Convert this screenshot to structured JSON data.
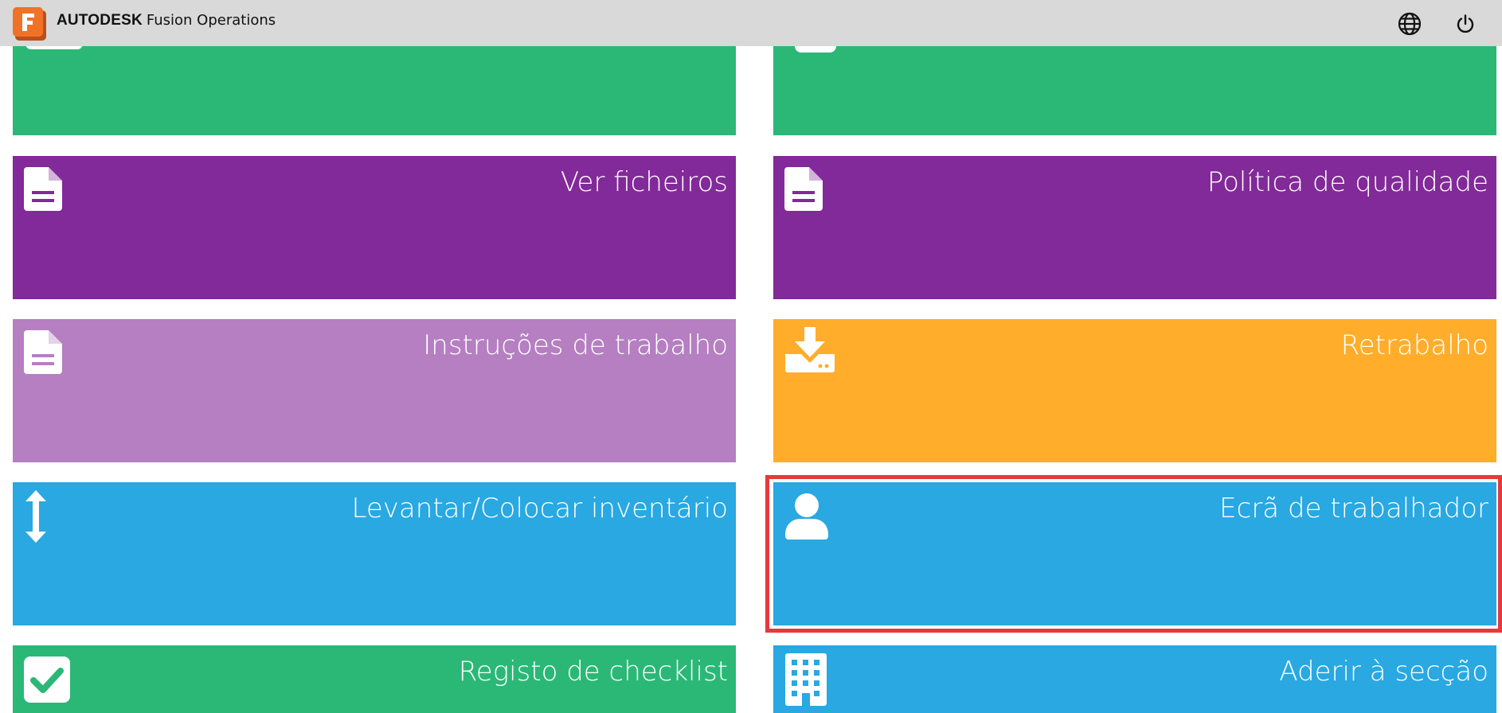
{
  "app": {
    "brand_bold": "AUTODESK",
    "brand_product": "Fusion Operations"
  },
  "header": {
    "icons": [
      "globe-icon",
      "power-icon"
    ]
  },
  "colors": {
    "green": "#2bb877",
    "purple": "#822a99",
    "lilac": "#b57fc2",
    "orange": "#ffad2a",
    "blue": "#29a8e2",
    "selection": "#e8383d"
  },
  "tiles": [
    {
      "id": "top-left",
      "label": "",
      "icon": "partial-icon",
      "color": "#2bb877"
    },
    {
      "id": "top-right",
      "label": "",
      "icon": "partial-icon",
      "color": "#2bb877"
    },
    {
      "id": "ver-ficheiros",
      "label": "Ver ficheiros",
      "icon": "document-icon",
      "color": "#822a99"
    },
    {
      "id": "politica-de-qualidade",
      "label": "Política de qualidade",
      "icon": "document-icon",
      "color": "#822a99"
    },
    {
      "id": "instrucoes-de-trabalho",
      "label": "Instruções de trabalho",
      "icon": "document-icon",
      "color": "#b57fc2"
    },
    {
      "id": "retrabalho",
      "label": "Retrabalho",
      "icon": "download-icon",
      "color": "#ffad2a"
    },
    {
      "id": "levantar-colocar-inventario",
      "label": "Levantar/Colocar inventário",
      "icon": "vertical-arrows-icon",
      "color": "#29a8e2"
    },
    {
      "id": "ecra-de-trabalhador",
      "label": "Ecrã de trabalhador",
      "icon": "user-icon",
      "color": "#29a8e2",
      "selected": true
    },
    {
      "id": "registo-de-checklist",
      "label": "Registo de checklist",
      "icon": "checkbox-icon",
      "color": "#2bb877"
    },
    {
      "id": "aderir-a-seccao",
      "label": "Aderir à secção",
      "icon": "building-icon",
      "color": "#29a8e2"
    }
  ]
}
